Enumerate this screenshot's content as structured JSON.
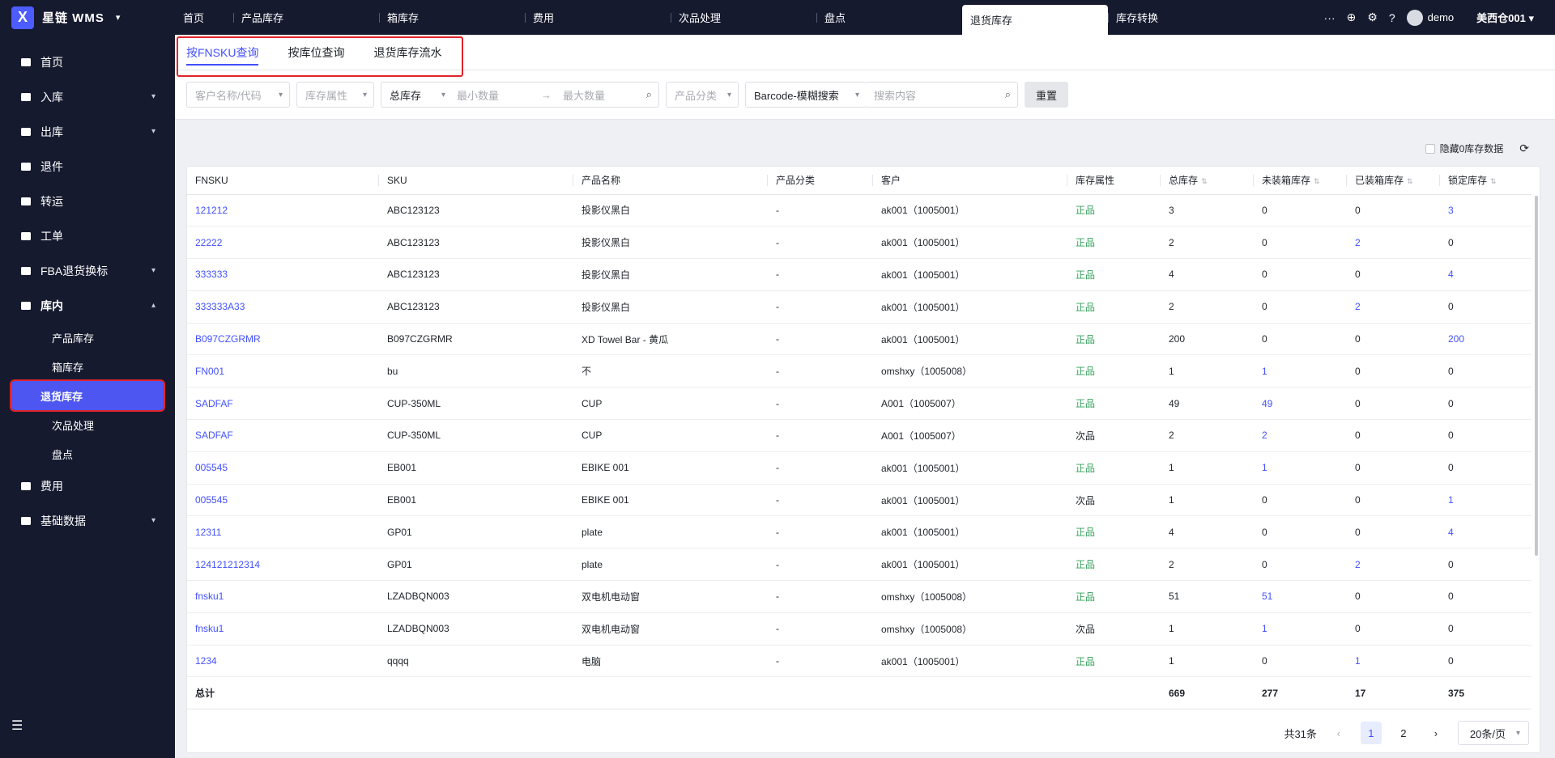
{
  "app": {
    "brand": "星链 WMS"
  },
  "sidebar": {
    "items": [
      {
        "label": "首页",
        "icon": "home-icon",
        "chevron": ""
      },
      {
        "label": "入库",
        "icon": "inbound-icon",
        "chevron": "▾"
      },
      {
        "label": "出库",
        "icon": "outbound-icon",
        "chevron": "▾"
      },
      {
        "label": "退件",
        "icon": "return-icon",
        "chevron": ""
      },
      {
        "label": "转运",
        "icon": "truck-icon",
        "chevron": ""
      },
      {
        "label": "工单",
        "icon": "workorder-icon",
        "chevron": ""
      },
      {
        "label": "FBA退货换标",
        "icon": "fba-icon",
        "chevron": "▾"
      },
      {
        "label": "库内",
        "icon": "warehouse-icon",
        "chevron": "▴"
      }
    ],
    "sub_items": [
      "产品库存",
      "箱库存",
      "退货库存",
      "次品处理",
      "盘点"
    ],
    "items_after": [
      {
        "label": "费用",
        "icon": "fee-icon",
        "chevron": ""
      },
      {
        "label": "基础数据",
        "icon": "chart-icon",
        "chevron": "▾"
      }
    ]
  },
  "topbar": {
    "tabs": [
      "首页",
      "产品库存",
      "箱库存",
      "费用",
      "次品处理",
      "盘点",
      "退货库存",
      "库存转换"
    ],
    "more": "···",
    "user": "demo",
    "warehouse": "美西仓001"
  },
  "subtabs": [
    "按FNSKU查询",
    "按库位查询",
    "退货库存流水"
  ],
  "filters": {
    "customer": "客户名称/代码",
    "attr": "库存属性",
    "stock_type": "总库存",
    "min_qty": "最小数量",
    "arrow": "→",
    "max_qty": "最大数量",
    "category": "产品分类",
    "search_type": "Barcode-模糊搜索",
    "search_placeholder": "搜索内容",
    "reset": "重置"
  },
  "toolbar": {
    "hide_zero": "隐藏0库存数据"
  },
  "table": {
    "headers": [
      "FNSKU",
      "SKU",
      "产品名称",
      "产品分类",
      "客户",
      "库存属性",
      "总库存",
      "未装箱库存",
      "已装箱库存",
      "锁定库存"
    ],
    "rows": [
      [
        "121212",
        "ABC123123",
        "投影仪黑白",
        "-",
        "ak001（1005001）",
        "正品",
        "3",
        "0",
        "0",
        "3"
      ],
      [
        "22222",
        "ABC123123",
        "投影仪黑白",
        "-",
        "ak001（1005001）",
        "正品",
        "2",
        "0",
        "2",
        "0"
      ],
      [
        "333333",
        "ABC123123",
        "投影仪黑白",
        "-",
        "ak001（1005001）",
        "正品",
        "4",
        "0",
        "0",
        "4"
      ],
      [
        "333333A33",
        "ABC123123",
        "投影仪黑白",
        "-",
        "ak001（1005001）",
        "正品",
        "2",
        "0",
        "2",
        "0"
      ],
      [
        "B097CZGRMR",
        "B097CZGRMR",
        "XD Towel Bar - 黄瓜",
        "-",
        "ak001（1005001）",
        "正品",
        "200",
        "0",
        "0",
        "200"
      ],
      [
        "FN001",
        "bu",
        "不",
        "-",
        "omshxy（1005008）",
        "正品",
        "1",
        "1",
        "0",
        "0"
      ],
      [
        "SADFAF",
        "CUP-350ML",
        "CUP",
        "-",
        "A001（1005007）",
        "正品",
        "49",
        "49",
        "0",
        "0"
      ],
      [
        "SADFAF",
        "CUP-350ML",
        "CUP",
        "-",
        "A001（1005007）",
        "次品",
        "2",
        "2",
        "0",
        "0"
      ],
      [
        "005545",
        "EB001",
        "EBIKE 001",
        "-",
        "ak001（1005001）",
        "正品",
        "1",
        "1",
        "0",
        "0"
      ],
      [
        "005545",
        "EB001",
        "EBIKE 001",
        "-",
        "ak001（1005001）",
        "次品",
        "1",
        "0",
        "0",
        "1"
      ],
      [
        "12311",
        "GP01",
        "plate",
        "-",
        "ak001（1005001）",
        "正品",
        "4",
        "0",
        "0",
        "4"
      ],
      [
        "124121212314",
        "GP01",
        "plate",
        "-",
        "ak001（1005001）",
        "正品",
        "2",
        "0",
        "2",
        "0"
      ],
      [
        "fnsku1",
        "LZADBQN003",
        "双电机电动窗",
        "-",
        "omshxy（1005008）",
        "正品",
        "51",
        "51",
        "0",
        "0"
      ],
      [
        "fnsku1",
        "LZADBQN003",
        "双电机电动窗",
        "-",
        "omshxy（1005008）",
        "次品",
        "1",
        "1",
        "0",
        "0"
      ],
      [
        "1234",
        "qqqq",
        "电脑",
        "-",
        "ak001（1005001）",
        "正品",
        "1",
        "0",
        "1",
        "0"
      ]
    ],
    "total": {
      "label": "总计",
      "total": "669",
      "unboxed": "277",
      "boxed": "17",
      "locked": "375"
    }
  },
  "pager": {
    "summary": "共31条",
    "prev": "‹",
    "pages": [
      "1",
      "2"
    ],
    "next": "›",
    "size": "20条/页"
  },
  "colors": {
    "accent": "#4250ff",
    "good": "#33a35a",
    "sidebar_bg": "#161a2f",
    "highlight": "#e0242b"
  }
}
